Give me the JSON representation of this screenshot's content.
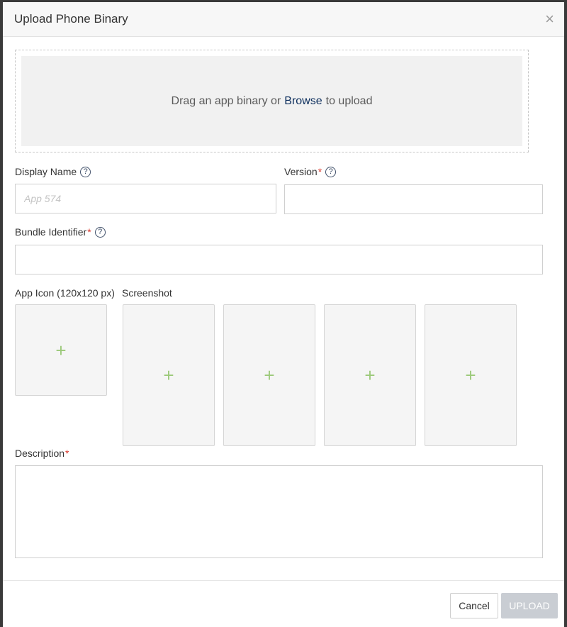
{
  "dialog": {
    "title": "Upload Phone Binary",
    "close_symbol": "×"
  },
  "dropzone": {
    "text_before": "Drag an app binary or",
    "browse_label": "Browse",
    "text_after": "to upload"
  },
  "fields": {
    "display_name": {
      "label": "Display Name",
      "placeholder": "App 574",
      "value": ""
    },
    "version": {
      "label": "Version",
      "required_mark": "*",
      "value": ""
    },
    "bundle_identifier": {
      "label": "Bundle Identifier",
      "required_mark": "*",
      "value": ""
    },
    "description": {
      "label": "Description",
      "required_mark": "*",
      "value": ""
    }
  },
  "help_symbol": "?",
  "media": {
    "app_icon_label": "App Icon (120x120 px)",
    "screenshot_label": "Screenshot",
    "add_symbol": "+",
    "screenshot_slots": 4
  },
  "footer": {
    "cancel_label": "Cancel",
    "upload_label": "UPLOAD"
  },
  "colors": {
    "accent_plus": "#9cc97a",
    "link": "#0b2d5c",
    "required": "#d9372b",
    "upload_disabled": "#c9cdd3"
  }
}
